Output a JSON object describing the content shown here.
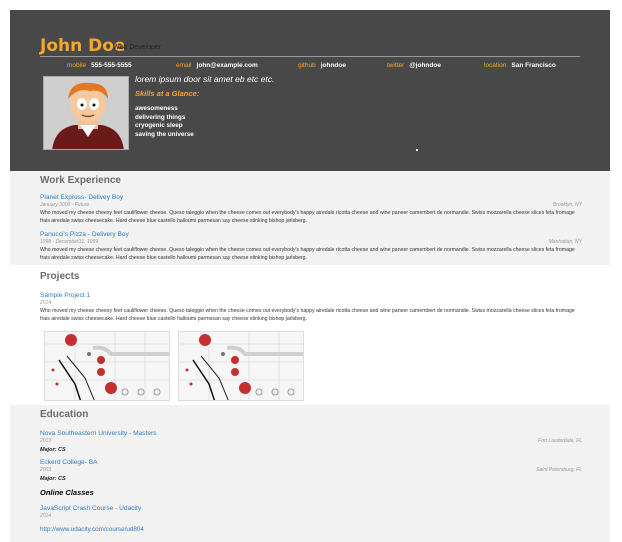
{
  "header": {
    "name": "John Doe",
    "role": "Web Developer",
    "contacts": [
      {
        "key": "mobile",
        "value": "555-555-5555"
      },
      {
        "key": "email",
        "value": "john@example.com"
      },
      {
        "key": "github",
        "value": "johndoe"
      },
      {
        "key": "twitter",
        "value": "@johndoe"
      },
      {
        "key": "location",
        "value": "San Francisco"
      }
    ],
    "tagline": "lorem ipsum door sit amet eb etc etc.",
    "skills_heading": "Skills at a Glance:",
    "skills": [
      "awesomeness",
      "delivering things",
      "cryogenic sleep",
      "saving the universe"
    ]
  },
  "work": {
    "heading": "Work Experience",
    "jobs": [
      {
        "title": "Planet Express- Delivey Boy",
        "dates": "January 3000 - Future",
        "location": "Brooklyn, NY",
        "description": "Who moved my cheese cheesy feet cauliflower cheese. Queso taleggio when the cheese comes out everybody's happy airedale ricotta cheese and wine paneer camembert de normandie. Swiss mozzarella cheese slices feta fromage frais airedale swiss cheesecake. Hard cheese blue castello halloumi parmesan say cheese stinking bishop jarlsberg."
      },
      {
        "title": "Panucci's Pizza - Delivery Boy",
        "dates": "1998 - December31, 1999",
        "location": "Manhattan, NY",
        "description": "Who moved my cheese cheesy feet cauliflower cheese. Queso taleggio when the cheese comes out everybody's happy airedale ricotta cheese and wine paneer camembert de normandie. Swiss mozzarella cheese slices feta fromage frais airedale swiss cheesecake. Hard cheese blue castello halloumi parmesan say cheese stinking bishop jarlsberg."
      }
    ]
  },
  "projects": {
    "heading": "Projects",
    "items": [
      {
        "title": "Sample Project 1",
        "dates": "2014",
        "description": "Who moved my cheese cheesy feet cauliflower cheese. Queso taleggio when the cheese comes out everybody's happy airedale ricotta cheese and wine paneer camembert de normandie. Swiss mozzarella cheese slices feta fromage frais airedale swiss cheesecake. Hard cheese blue castello halloumi parmesan say cheese stinking bishop jarlsberg."
      }
    ]
  },
  "education": {
    "heading": "Education",
    "schools": [
      {
        "title": "Nova Southeastern University - Masters",
        "dates": "2013",
        "location": "Fort Lauderdale, FL",
        "major": "Major: CS"
      },
      {
        "title": "Eckerd College- BA",
        "dates": "2003",
        "location": "Saint Petersburg, FL",
        "major": "Major: CS"
      }
    ],
    "online_heading": "Online Classes",
    "online": [
      {
        "title": "JavaScript Crash Course - Udacity",
        "dates": "2014",
        "url": "http://www.udacity.com/course/ud804"
      }
    ]
  },
  "colors": {
    "header_bg": "#484848",
    "accent": "#f4a82e",
    "link": "#2f7cc2"
  }
}
